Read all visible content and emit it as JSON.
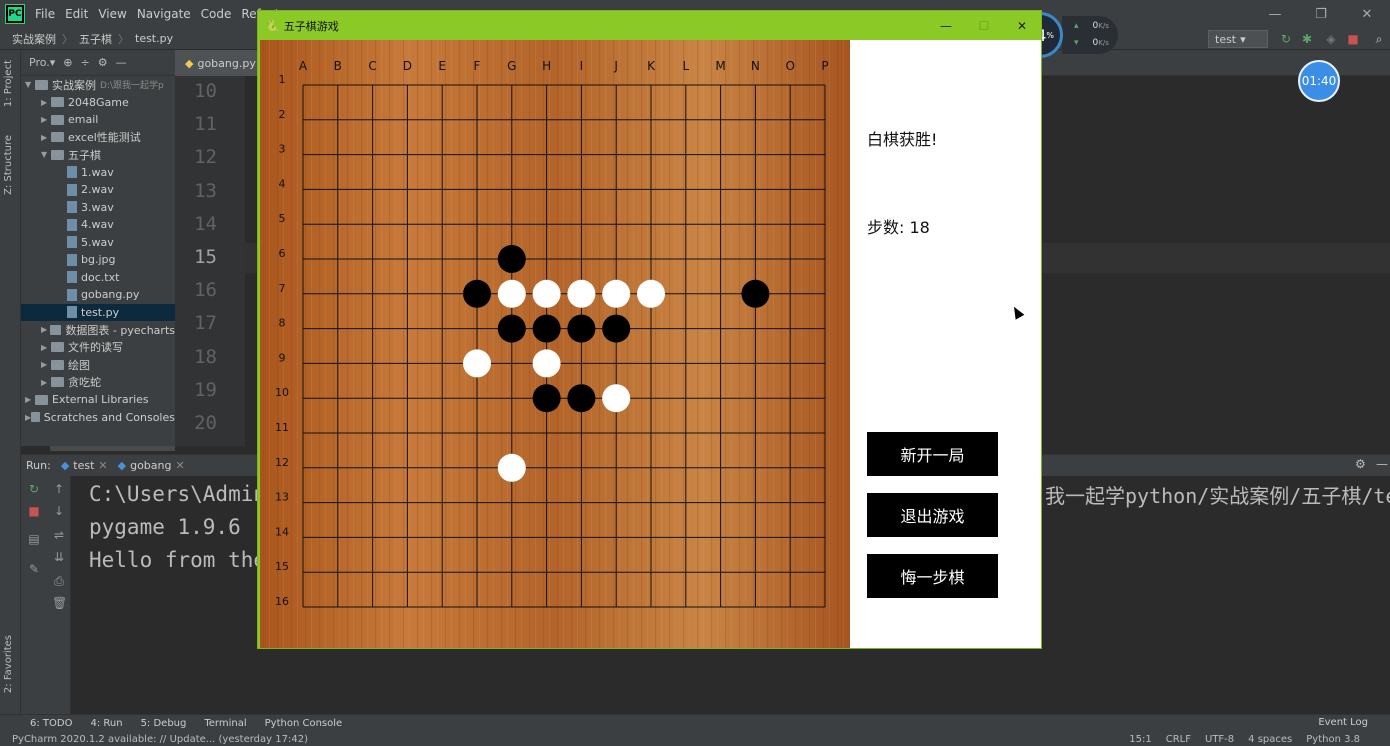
{
  "ide": {
    "menu": [
      "File",
      "Edit",
      "View",
      "Navigate",
      "Code",
      "Refactor"
    ],
    "logo": "PC",
    "breadcrumb": [
      "实战案例",
      "五子棋",
      "test.py"
    ],
    "run_config": "test",
    "project_label": "Pro.▾",
    "left_tabs": [
      "1: Project",
      "Z: Structure",
      "2: Favorites"
    ],
    "editor_tab": "gobang.py",
    "line_numbers": [
      "10",
      "11",
      "12",
      "13",
      "14",
      "15",
      "16",
      "17",
      "18",
      "19",
      "20"
    ],
    "current_line": "15",
    "tree": [
      {
        "label": "实战案例",
        "extra": "D:\\跟我一起学p",
        "type": "folder",
        "level": 0,
        "open": true
      },
      {
        "label": "2048Game",
        "type": "folder",
        "level": 1
      },
      {
        "label": "email",
        "type": "folder",
        "level": 1
      },
      {
        "label": "excel性能测试",
        "type": "folder",
        "level": 1
      },
      {
        "label": "五子棋",
        "type": "folder",
        "level": 1,
        "open": true
      },
      {
        "label": "1.wav",
        "type": "file",
        "level": 2
      },
      {
        "label": "2.wav",
        "type": "file",
        "level": 2
      },
      {
        "label": "3.wav",
        "type": "file",
        "level": 2
      },
      {
        "label": "4.wav",
        "type": "file",
        "level": 2
      },
      {
        "label": "5.wav",
        "type": "file",
        "level": 2
      },
      {
        "label": "bg.jpg",
        "type": "file",
        "level": 2
      },
      {
        "label": "doc.txt",
        "type": "file",
        "level": 2
      },
      {
        "label": "gobang.py",
        "type": "file",
        "level": 2
      },
      {
        "label": "test.py",
        "type": "file",
        "level": 2,
        "selected": true
      },
      {
        "label": "数据图表 - pyecharts",
        "type": "folder",
        "level": 1
      },
      {
        "label": "文件的读写",
        "type": "folder",
        "level": 1
      },
      {
        "label": "绘图",
        "type": "folder",
        "level": 1
      },
      {
        "label": "贪吃蛇",
        "type": "folder",
        "level": 1
      },
      {
        "label": "External Libraries",
        "type": "lib",
        "level": 0
      },
      {
        "label": "Scratches and Consoles",
        "type": "lib",
        "level": 0
      }
    ],
    "run_label": "Run:",
    "run_tabs": [
      "test",
      "gobang"
    ],
    "console_lines": [
      "C:\\Users\\Admin",
      "pygame 1.9.6",
      "Hello from the"
    ],
    "console_right": "我一起学python/实战案例/五子棋/te",
    "bottom_tabs": [
      "6: TODO",
      "4: Run",
      "5: Debug",
      "Terminal",
      "Python Console"
    ],
    "event_log": "Event Log",
    "status_left": "PyCharm 2020.1.2 available: // Update... (yesterday 17:42)",
    "status_right": [
      "15:1",
      "CRLF",
      "UTF-8",
      "4 spaces",
      "Python 3.8"
    ],
    "cpu": "64",
    "cpu_unit": "%",
    "net_up": "0",
    "net_down": "0",
    "net_unit": "K/s",
    "timer": "01:40"
  },
  "game": {
    "title": "五子棋游戏",
    "winner_text": "白棋获胜!",
    "steps_label": "步数: ",
    "steps_value": "18",
    "buttons": [
      "新开一局",
      "退出游戏",
      "悔一步棋"
    ],
    "cols": [
      "A",
      "B",
      "C",
      "D",
      "E",
      "F",
      "G",
      "H",
      "I",
      "J",
      "K",
      "L",
      "M",
      "N",
      "O",
      "P"
    ],
    "rows": [
      "1",
      "2",
      "3",
      "4",
      "5",
      "6",
      "7",
      "8",
      "9",
      "10",
      "11",
      "12",
      "13",
      "14",
      "15",
      "16"
    ],
    "stones": [
      {
        "col": "G",
        "row": 6,
        "color": "black"
      },
      {
        "col": "F",
        "row": 7,
        "color": "black"
      },
      {
        "col": "G",
        "row": 7,
        "color": "white"
      },
      {
        "col": "H",
        "row": 7,
        "color": "white"
      },
      {
        "col": "I",
        "row": 7,
        "color": "white"
      },
      {
        "col": "J",
        "row": 7,
        "color": "white"
      },
      {
        "col": "K",
        "row": 7,
        "color": "white"
      },
      {
        "col": "N",
        "row": 7,
        "color": "black"
      },
      {
        "col": "G",
        "row": 8,
        "color": "black"
      },
      {
        "col": "H",
        "row": 8,
        "color": "black"
      },
      {
        "col": "I",
        "row": 8,
        "color": "black"
      },
      {
        "col": "J",
        "row": 8,
        "color": "black"
      },
      {
        "col": "F",
        "row": 9,
        "color": "white"
      },
      {
        "col": "H",
        "row": 9,
        "color": "white"
      },
      {
        "col": "H",
        "row": 10,
        "color": "black"
      },
      {
        "col": "I",
        "row": 10,
        "color": "black"
      },
      {
        "col": "J",
        "row": 10,
        "color": "white"
      },
      {
        "col": "G",
        "row": 12,
        "color": "white"
      }
    ]
  }
}
